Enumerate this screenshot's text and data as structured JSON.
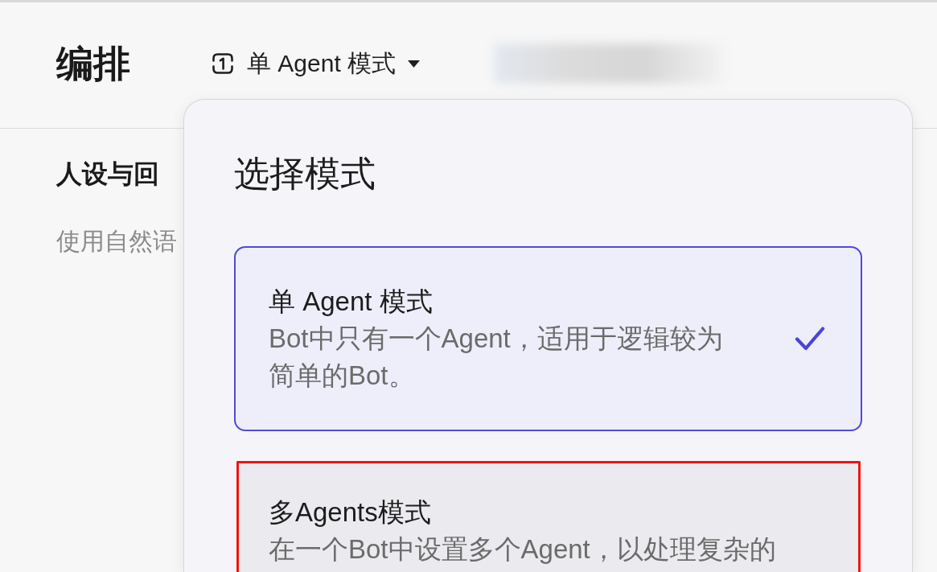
{
  "header": {
    "title": "编排",
    "mode_switch": {
      "label": "单 Agent 模式",
      "expanded": true
    }
  },
  "left_panel": {
    "section_title": "人设与回",
    "hint": "使用自然语"
  },
  "mode_popup": {
    "title": "选择模式",
    "options": [
      {
        "title": "单 Agent 模式",
        "description": "Bot中只有一个Agent，适用于逻辑较为简单的Bot。",
        "selected": true,
        "highlighted": false
      },
      {
        "title": "多Agents模式",
        "description": "在一个Bot中设置多个Agent，以处理复杂的",
        "selected": false,
        "highlighted": true
      }
    ]
  }
}
